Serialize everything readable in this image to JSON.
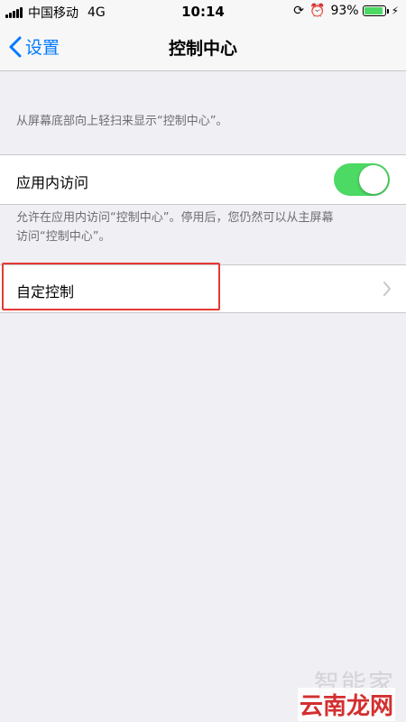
{
  "status_bar": {
    "carrier": "中国移动",
    "network": "4G",
    "time": "10:14",
    "battery_percent": "93%",
    "battery_level": 0.93
  },
  "nav": {
    "back_label": "设置",
    "title": "控制中心"
  },
  "notes": {
    "swipe_hint": "从屏幕底部向上轻扫来显示“控制中心”。",
    "in_app_description_line1": "允许在应用内访问“控制中心”。停用后，您仍然可以从主屏幕",
    "in_app_description_line2": "访问“控制中心”。"
  },
  "settings": {
    "in_app_access_label": "应用内访问",
    "in_app_access_on": true,
    "customize_label": "自定控制"
  },
  "watermark": {
    "faint": "智能家",
    "logo": "云南龙网"
  },
  "colors": {
    "accent": "#007AFF",
    "toggle_on": "#4CD964",
    "highlight": "#E53935"
  }
}
